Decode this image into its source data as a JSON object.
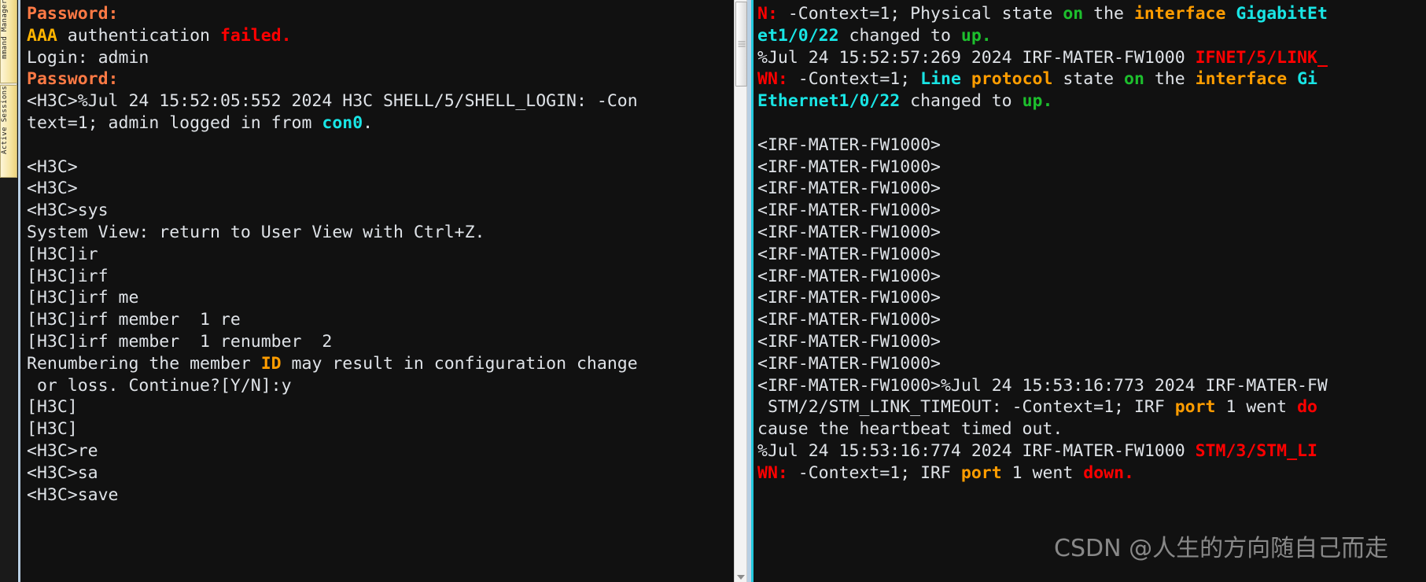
{
  "sidebar": {
    "tabs": [
      {
        "label": "mmand Manager",
        "name": "command-manager"
      },
      {
        "label": "Active Sessions",
        "name": "active-sessions"
      }
    ]
  },
  "scrollbar": {
    "thumb_position": "top",
    "arrow_down": "▼"
  },
  "colors": {
    "background": "#111111",
    "foreground": "#dfe3e8",
    "orange": "#ff7a45",
    "yellow": "#ffb400",
    "red": "#ff0000",
    "cyan": "#19e5e5",
    "green": "#1dbf2d",
    "gold": "#ff9d00",
    "tab": "#f7e7a8",
    "pane_border": "#b9cfe3"
  },
  "left_terminal": {
    "name": "h3c-console-session",
    "lines": [
      [
        {
          "t": "Password:",
          "c": "orange"
        }
      ],
      [
        {
          "t": "AAA",
          "c": "yellow"
        },
        {
          "t": " authentication ",
          "c": "def"
        },
        {
          "t": "failed.",
          "c": "red"
        }
      ],
      [
        {
          "t": "Login: admin",
          "c": "def"
        }
      ],
      [
        {
          "t": "Password:",
          "c": "orange"
        }
      ],
      [
        {
          "t": "<H3C>%Jul 24 15:52:05:552 2024 H3C SHELL/5/SHELL_LOGIN: -Con",
          "c": "def"
        }
      ],
      [
        {
          "t": "text=1; admin logged in from ",
          "c": "def"
        },
        {
          "t": "con0",
          "c": "cyan"
        },
        {
          "t": ".",
          "c": "def"
        }
      ],
      [
        {
          "t": "",
          "c": "def"
        }
      ],
      [
        {
          "t": "<H3C>",
          "c": "def"
        }
      ],
      [
        {
          "t": "<H3C>",
          "c": "def"
        }
      ],
      [
        {
          "t": "<H3C>sys",
          "c": "def"
        }
      ],
      [
        {
          "t": "System View: return to User View with Ctrl+Z.",
          "c": "def"
        }
      ],
      [
        {
          "t": "[H3C]ir",
          "c": "def"
        }
      ],
      [
        {
          "t": "[H3C]irf",
          "c": "def"
        }
      ],
      [
        {
          "t": "[H3C]irf me",
          "c": "def"
        }
      ],
      [
        {
          "t": "[H3C]irf member  1 re",
          "c": "def"
        }
      ],
      [
        {
          "t": "[H3C]irf member  1 renumber  2",
          "c": "def"
        }
      ],
      [
        {
          "t": "Renumbering the member ",
          "c": "def"
        },
        {
          "t": "ID",
          "c": "gold"
        },
        {
          "t": " may result in configuration change",
          "c": "def"
        }
      ],
      [
        {
          "t": " or loss. Continue?[Y/N]:y",
          "c": "def"
        }
      ],
      [
        {
          "t": "[H3C]",
          "c": "def"
        }
      ],
      [
        {
          "t": "[H3C]",
          "c": "def"
        }
      ],
      [
        {
          "t": "<H3C>re",
          "c": "def"
        }
      ],
      [
        {
          "t": "<H3C>sa",
          "c": "def"
        }
      ],
      [
        {
          "t": "<H3C>save",
          "c": "def"
        }
      ]
    ]
  },
  "right_terminal": {
    "name": "irf-master-console-session",
    "lines": [
      [
        {
          "t": "N:",
          "c": "red"
        },
        {
          "t": " -Context=1; Physical state ",
          "c": "def"
        },
        {
          "t": "on",
          "c": "green"
        },
        {
          "t": " the ",
          "c": "def"
        },
        {
          "t": "interface",
          "c": "gold"
        },
        {
          "t": " ",
          "c": "def"
        },
        {
          "t": "GigabitEt",
          "c": "cyan"
        }
      ],
      [
        {
          "t": "et1/0/22",
          "c": "cyan"
        },
        {
          "t": " changed to ",
          "c": "def"
        },
        {
          "t": "up.",
          "c": "green"
        }
      ],
      [
        {
          "t": "%Jul 24 15:52:57:269 2024 IRF-MATER-FW1000 ",
          "c": "def"
        },
        {
          "t": "IFNET/5/LINK_",
          "c": "red"
        }
      ],
      [
        {
          "t": "WN:",
          "c": "red"
        },
        {
          "t": " -Context=1; ",
          "c": "def"
        },
        {
          "t": "Line",
          "c": "cyan"
        },
        {
          "t": " ",
          "c": "def"
        },
        {
          "t": "protocol",
          "c": "gold"
        },
        {
          "t": " state ",
          "c": "def"
        },
        {
          "t": "on",
          "c": "green"
        },
        {
          "t": " the ",
          "c": "def"
        },
        {
          "t": "interface",
          "c": "gold"
        },
        {
          "t": " ",
          "c": "def"
        },
        {
          "t": "Gi",
          "c": "cyan"
        }
      ],
      [
        {
          "t": "Ethernet1/0/22",
          "c": "cyan"
        },
        {
          "t": " changed to ",
          "c": "def"
        },
        {
          "t": "up.",
          "c": "green"
        }
      ],
      [
        {
          "t": "",
          "c": "def"
        }
      ],
      [
        {
          "t": "<IRF-MATER-FW1000>",
          "c": "def"
        }
      ],
      [
        {
          "t": "<IRF-MATER-FW1000>",
          "c": "def"
        }
      ],
      [
        {
          "t": "<IRF-MATER-FW1000>",
          "c": "def"
        }
      ],
      [
        {
          "t": "<IRF-MATER-FW1000>",
          "c": "def"
        }
      ],
      [
        {
          "t": "<IRF-MATER-FW1000>",
          "c": "def"
        }
      ],
      [
        {
          "t": "<IRF-MATER-FW1000>",
          "c": "def"
        }
      ],
      [
        {
          "t": "<IRF-MATER-FW1000>",
          "c": "def"
        }
      ],
      [
        {
          "t": "<IRF-MATER-FW1000>",
          "c": "def"
        }
      ],
      [
        {
          "t": "<IRF-MATER-FW1000>",
          "c": "def"
        }
      ],
      [
        {
          "t": "<IRF-MATER-FW1000>",
          "c": "def"
        }
      ],
      [
        {
          "t": "<IRF-MATER-FW1000>",
          "c": "def"
        }
      ],
      [
        {
          "t": "<IRF-MATER-FW1000>%Jul 24 15:53:16:773 2024 IRF-MATER-FW",
          "c": "def"
        }
      ],
      [
        {
          "t": " STM/2/STM_LINK_TIMEOUT: -Context=1; IRF ",
          "c": "def"
        },
        {
          "t": "port",
          "c": "gold"
        },
        {
          "t": " 1 went ",
          "c": "def"
        },
        {
          "t": "do",
          "c": "red"
        }
      ],
      [
        {
          "t": "cause the heartbeat timed out.",
          "c": "def"
        }
      ],
      [
        {
          "t": "%Jul 24 15:53:16:774 2024 IRF-MATER-FW1000 ",
          "c": "def"
        },
        {
          "t": "STM/3/STM_LI",
          "c": "red"
        }
      ],
      [
        {
          "t": "WN:",
          "c": "red"
        },
        {
          "t": " -Context=1; IRF ",
          "c": "def"
        },
        {
          "t": "port",
          "c": "gold"
        },
        {
          "t": " 1 went ",
          "c": "def"
        },
        {
          "t": "down.",
          "c": "red"
        }
      ]
    ]
  },
  "watermark": {
    "text": "CSDN @人生的方向随自己而走"
  }
}
